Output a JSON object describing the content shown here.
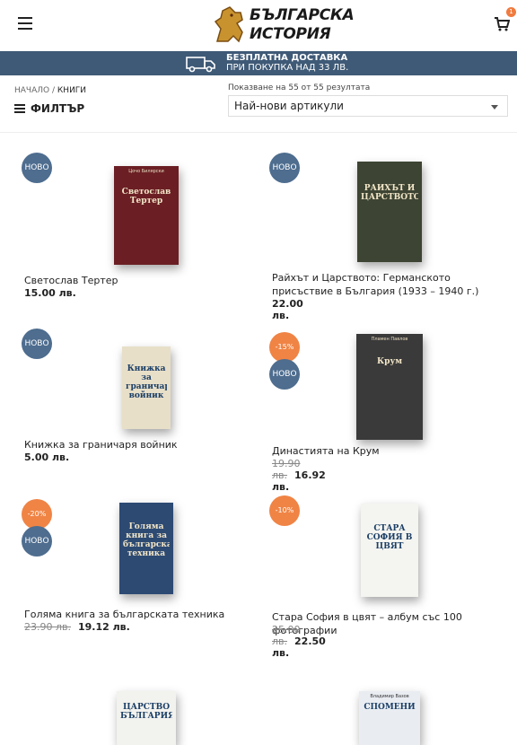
{
  "header": {
    "menu_icon": "hamburger-icon",
    "logo_line1": "БЪЛГАРСКА",
    "logo_line2": "ИСТОРИЯ",
    "cart_icon": "cart-icon",
    "cart_count": "1"
  },
  "banner": {
    "icon": "truck-icon",
    "line1": "БЕЗПЛАТНА ДОСТАВКА",
    "line2": "ПРИ ПОКУПКА НАД 33 ЛВ."
  },
  "breadcrumb": {
    "home": "НАЧАЛО",
    "separator": "/",
    "current": "КНИГИ"
  },
  "filter": {
    "label": "ФИЛТЪР",
    "icon": "menu-lines-icon"
  },
  "results_text": "Показване на 55 от 55 резултата",
  "sort": {
    "selected": "Най-нови артикули"
  },
  "products": [
    {
      "name": "Светослав Тертер",
      "price": "15.00 лв.",
      "old_price": "",
      "badges": [
        "НОВО"
      ],
      "cover_title": "Светослав Тертер",
      "cover_author": "Цочо Билярски",
      "cover_color": "#6b1f24"
    },
    {
      "name": "Райхът и Царството: Германското присъствие в България (1933 – 1940 г.)",
      "price": "22.00 лв.",
      "old_price": "",
      "badges": [
        "НОВО"
      ],
      "cover_title": "РАЙХЪТ И ЦАРСТВОТО",
      "cover_author": "",
      "cover_color": "#3d4433"
    },
    {
      "name": "Книжка за граничаря войник",
      "price": "5.00 лв.",
      "old_price": "",
      "badges": [
        "НОВО"
      ],
      "cover_title": "Книжка за граничаря войник",
      "cover_author": "",
      "cover_color": "#e8dfc8"
    },
    {
      "name": "Династията на Крум",
      "price": "16.92 лв.",
      "old_price": "19.90 лв.",
      "badges": [
        "-15%",
        "НОВО"
      ],
      "cover_title": "Крум",
      "cover_author": "Пламен Павлов",
      "cover_color": "#3a3a3a"
    },
    {
      "name": "Голяма книга за българската техника",
      "price": "19.12 лв.",
      "old_price": "23.90 лв.",
      "badges": [
        "-20%",
        "НОВО"
      ],
      "cover_title": "Голяма книга за българската техника",
      "cover_author": "",
      "cover_color": "#2d4a73"
    },
    {
      "name": "Стара София в цвят – албум със 100 фотографии",
      "price": "22.50 лв.",
      "old_price": "25.00 лв.",
      "badges": [
        "-10%"
      ],
      "cover_title": "СТАРА СОФИЯ В ЦВЯТ",
      "cover_author": "",
      "cover_color": "#f4f4f0"
    },
    {
      "name": "",
      "price": "",
      "old_price": "",
      "badges": [],
      "cover_title": "ЦАРСТВО БЪЛГАРИЯ",
      "cover_author": "",
      "cover_color": "#f2f2ee"
    },
    {
      "name": "",
      "price": "",
      "old_price": "",
      "badges": [],
      "cover_title": "СПОМЕНИ",
      "cover_author": "Владимир Вазов",
      "cover_color": "#e9edf2"
    }
  ]
}
